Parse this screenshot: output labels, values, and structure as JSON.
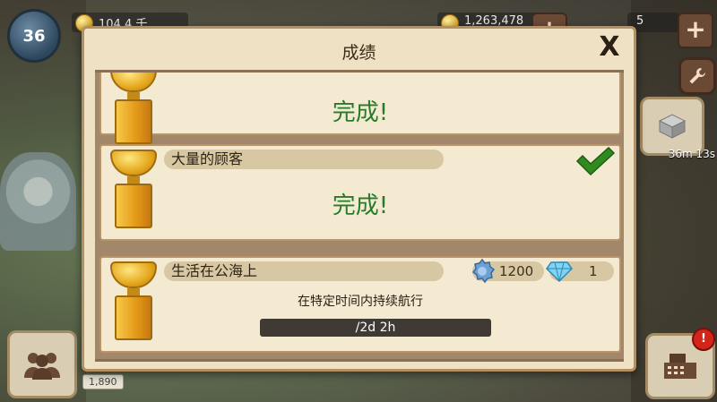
{
  "hud": {
    "level": "36",
    "coins_text": "104.4 千",
    "cash_text": "1,263,478",
    "gems_text": "5",
    "timer": "36m 13s",
    "bottom_balance": "1,890",
    "register_notifications": "!"
  },
  "dialog": {
    "title": "成绩",
    "close_label": "X"
  },
  "achievements": [
    {
      "name": "",
      "status": "完成!",
      "completed": true
    },
    {
      "name": "大量的顾客",
      "status": "完成!",
      "completed": true
    },
    {
      "name": "生活在公海上",
      "description": "在特定时间内持续航行",
      "reward_coins": "1200",
      "reward_gems": "1",
      "progress_text": "/2d 2h",
      "progress_fraction": 0,
      "completed": false
    }
  ],
  "colors": {
    "complete_green": "#287b2a",
    "panel": "#efe2c4"
  },
  "icons": [
    "trophy-icon",
    "checkmark-icon",
    "gear-icon",
    "diamond-icon",
    "close-icon",
    "plus-icon",
    "wrench-icon",
    "people-icon",
    "cash-register-icon"
  ]
}
